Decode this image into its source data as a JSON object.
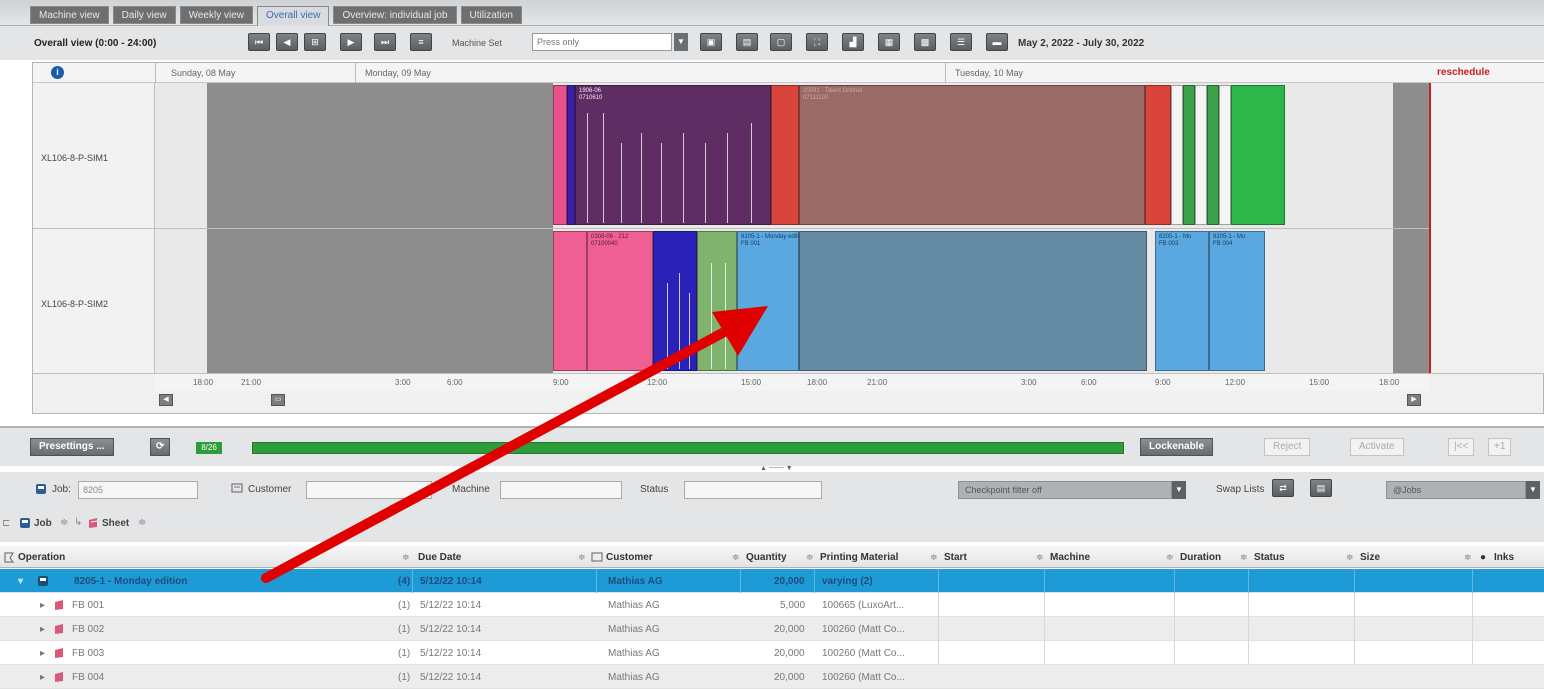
{
  "tabs": [
    "Machine view",
    "Daily view",
    "Weekly view",
    "Overall view",
    "Overview: individual job",
    "Utilization"
  ],
  "toolbar": {
    "title": "Overall view  (0:00 - 24:00)",
    "machine_set_label": "Machine Set",
    "machine_set_value": "Press only",
    "date_range": "May 2, 2022  -  July 30, 2022"
  },
  "gantt": {
    "days": [
      "Sunday, 08 May",
      "Monday, 09 May",
      "Tuesday, 10 May"
    ],
    "reschedule_label": "reschedule",
    "rows": [
      "XL106-8-P-SIM1",
      "XL106-8-P-SIM2"
    ],
    "bar_texts": {
      "b1": "1906-06\n0710610",
      "b2": "20591 · Talent Ordinal\n07111100",
      "b3": "0308-06 · 212\n07100040",
      "b4": "8205-1 - Monday edition\nFB 001",
      "b5": "8205-1 - Mo\nFB 003",
      "b6": "8205-1 - Mo\nFB 004"
    },
    "ticks": [
      "18:00",
      "21:00",
      "3:00",
      "6:00",
      "9:00",
      "12:00",
      "15:00",
      "18:00",
      "21:00",
      "3:00",
      "6:00",
      "9:00",
      "12:00",
      "15:00",
      "18:00"
    ]
  },
  "presettings": {
    "presettings_label": "Presettings ...",
    "count": "8/26",
    "lockenable_label": "Lockenable",
    "reject_label": "Reject",
    "activate_label": "Activate",
    "nav_label": "|<<",
    "plus_label": "+1"
  },
  "filters": {
    "job_label": "Job:",
    "job_value": "8205",
    "customer_label": "Customer",
    "machine_label": "Machine",
    "status_label": "Status",
    "checkpoint_value": "Checkpoint filter off",
    "swap_label": "Swap Lists",
    "jobs_value": "@Jobs",
    "group_job": "Job",
    "group_sheet": "Sheet"
  },
  "table": {
    "headers": [
      "Operation",
      "Due Date",
      "Customer",
      "Quantity",
      "Printing Material",
      "Start",
      "Machine",
      "Duration",
      "Status",
      "Size",
      "Inks"
    ],
    "rows": [
      {
        "op": "8205-1 - Monday edition",
        "count": "(4)",
        "due": "5/12/22 10:14",
        "customer": "Mathias AG",
        "qty": "20,000",
        "material": "varying (2)"
      },
      {
        "op": "FB 001",
        "count": "(1)",
        "due": "5/12/22 10:14",
        "customer": "Mathias AG",
        "qty": "5,000",
        "material": "100665 (LuxoArt..."
      },
      {
        "op": "FB 002",
        "count": "(1)",
        "due": "5/12/22 10:14",
        "customer": "Mathias AG",
        "qty": "20,000",
        "material": "100260 (Matt Co..."
      },
      {
        "op": "FB 003",
        "count": "(1)",
        "due": "5/12/22 10:14",
        "customer": "Mathias AG",
        "qty": "20,000",
        "material": "100260 (Matt Co..."
      },
      {
        "op": "FB 004",
        "count": "(1)",
        "due": "5/12/22 10:14",
        "customer": "Mathias AG",
        "qty": "20,000",
        "material": "100260 (Matt Co..."
      }
    ]
  },
  "colors": {
    "selection": "#1e9ad6",
    "arrow": "#e00000",
    "progress": "#2f9c3a",
    "reschedule": "#c81e1e"
  }
}
